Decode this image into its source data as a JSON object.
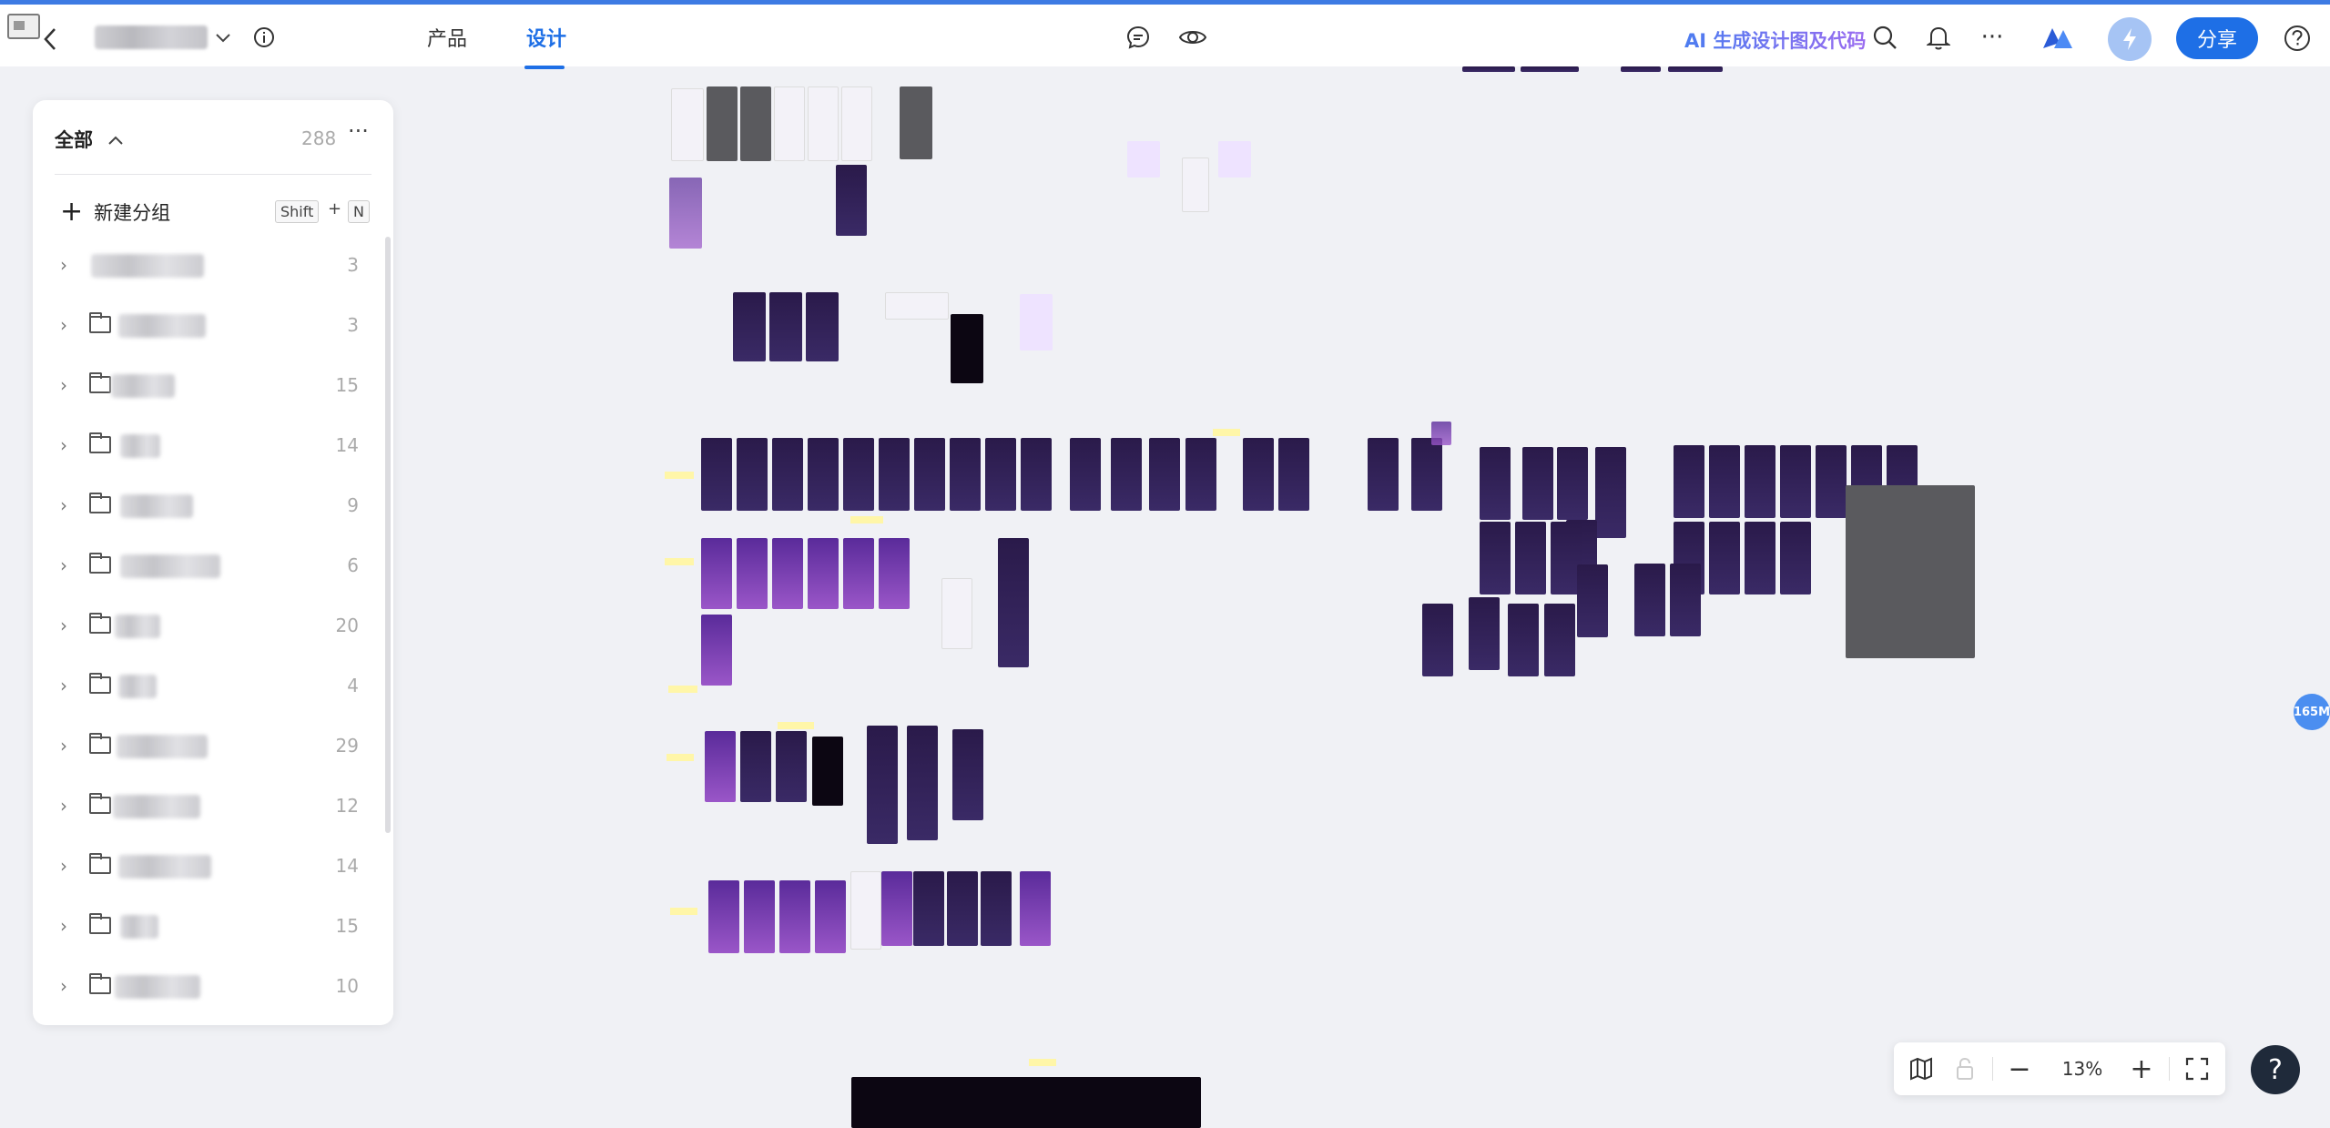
{
  "topbar": {
    "tabs": [
      {
        "label": "产品"
      },
      {
        "label": "设计"
      }
    ],
    "ai_link": "AI 生成设计图及代码",
    "share_label": "分享",
    "icons": [
      "back-icon",
      "chevron-down-icon",
      "info-icon",
      "comment-icon",
      "eye-icon",
      "search-icon",
      "bell-icon",
      "more-icon",
      "logo-icon",
      "bolt-icon",
      "help-icon"
    ],
    "accent": "#1e6fe6"
  },
  "sidebar": {
    "header": {
      "title": "全部",
      "count": "288"
    },
    "new_group": {
      "label": "新建分组",
      "shortcut_key1": "Shift",
      "shortcut_plus": "+",
      "shortcut_key2": "N"
    },
    "groups": [
      {
        "count": "3"
      },
      {
        "count": "3"
      },
      {
        "count": "15"
      },
      {
        "count": "14"
      },
      {
        "count": "9"
      },
      {
        "count": "6"
      },
      {
        "count": "20"
      },
      {
        "count": "4"
      },
      {
        "count": "29"
      },
      {
        "count": "12"
      },
      {
        "count": "14"
      },
      {
        "count": "15"
      },
      {
        "count": "10"
      }
    ]
  },
  "canvas": {
    "memory_badge": "165M"
  },
  "zoom": {
    "level": "13%",
    "minus": "−",
    "plus": "+"
  },
  "help_label": "?"
}
